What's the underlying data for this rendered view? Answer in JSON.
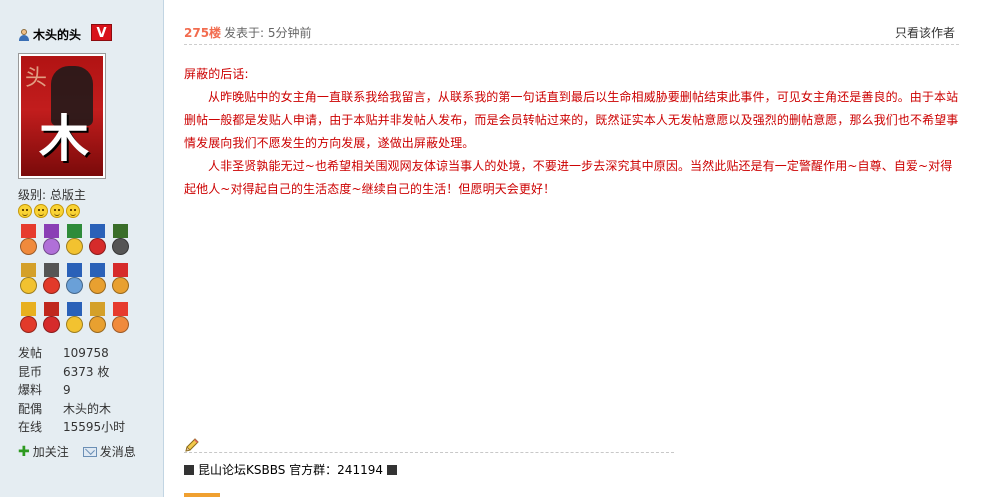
{
  "user": {
    "name": "木头的头",
    "badge": "V",
    "avatar_text_top": "头",
    "avatar_text_main": "木",
    "level": "级别: 总版主",
    "stats": [
      {
        "key": "发帖",
        "value": "109758"
      },
      {
        "key": "昆币",
        "value": "6373 枚"
      },
      {
        "key": "爆料",
        "value": "9"
      },
      {
        "key": "配偶",
        "value": "木头的木"
      },
      {
        "key": "在线",
        "value": "15595小时"
      }
    ],
    "follow_label": "加关注",
    "message_label": "发消息"
  },
  "post": {
    "floor": "275楼",
    "posted_at": "发表于: 5分钟前",
    "only_author": "只看该作者",
    "title_line": "屏蔽的后话:",
    "paragraph1": "从昨晚贴中的女主角一直联系我给我留言，从联系我的第一句话直到最后以生命相威胁要删帖结束此事件，可见女主角还是善良的。由于本站删帖一般都是发贴人申请，由于本贴并非发帖人发布，而是会员转帖过来的，既然证实本人无发帖意愿以及强烈的删帖意愿，那么我们也不希望事情发展向我们不愿发生的方向发展，遂做出屏蔽处理。",
    "paragraph2": "人非圣贤孰能无过~也希望相关围观网友体谅当事人的处境，不要进一步去深究其中原因。当然此贴还是有一定警醒作用~自尊、自爱~对得起他人~对得起自己的生活态度~继续自己的生活！但愿明天会更好！",
    "signature": "昆山论坛KSBBS 官方群：241194"
  },
  "colors": {
    "sidebar_bg": "#e5edf2",
    "floor": "#f26c4f",
    "content": "#cc0000",
    "badge": "#d8121a"
  },
  "medals": [
    {
      "ribbon": "#e63b2e",
      "disc": "#f08a3c"
    },
    {
      "ribbon": "#8a3fb5",
      "disc": "#b070d8"
    },
    {
      "ribbon": "#2e8b3a",
      "disc": "#f2c230"
    },
    {
      "ribbon": "#2a61b8",
      "disc": "#d62b2b"
    },
    {
      "ribbon": "#3a6e2a",
      "disc": "#555555"
    },
    {
      "ribbon": "#d4a02a",
      "disc": "#f2c230"
    },
    {
      "ribbon": "#555555",
      "disc": "#e23a2a"
    },
    {
      "ribbon": "#2a61b8",
      "disc": "#6aa0d8"
    },
    {
      "ribbon": "#2a61b8",
      "disc": "#e8a030"
    },
    {
      "ribbon": "#d62b2b",
      "disc": "#e8a030"
    },
    {
      "ribbon": "#e8b020",
      "disc": "#e23a2a"
    },
    {
      "ribbon": "#c0281e",
      "disc": "#d62b2b"
    },
    {
      "ribbon": "#2a61b8",
      "disc": "#f2c230"
    },
    {
      "ribbon": "#d4a02a",
      "disc": "#e8a030"
    },
    {
      "ribbon": "#e63b2e",
      "disc": "#f08a3c"
    }
  ]
}
